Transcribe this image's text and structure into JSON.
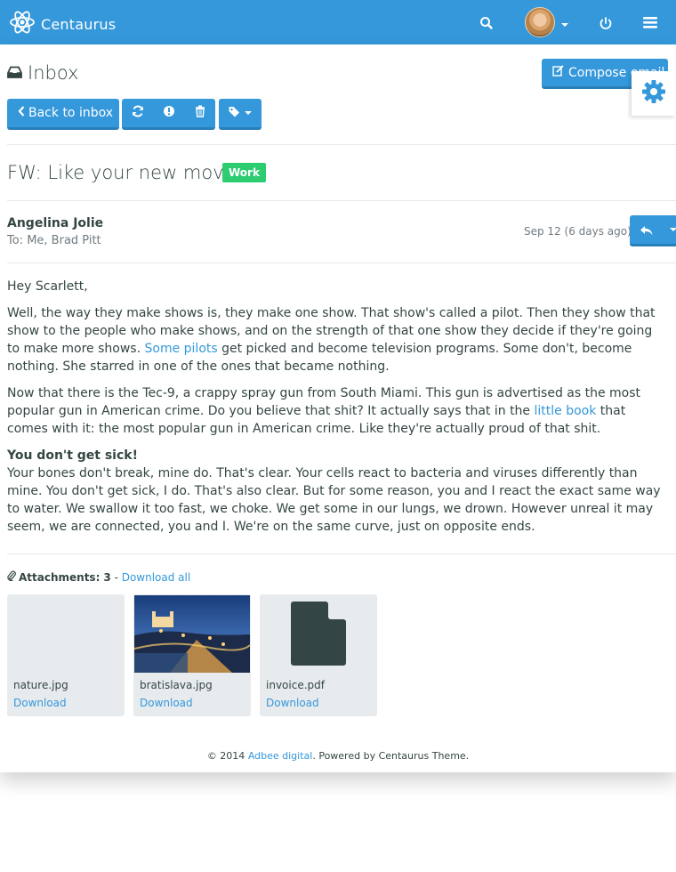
{
  "navbar": {
    "brand": "Centaurus",
    "icons": [
      "atom-logo-icon",
      "search-icon",
      "user-avatar",
      "power-icon",
      "menu-icon"
    ]
  },
  "inbox": {
    "title": "Inbox",
    "compose_label": "Compose email",
    "back_label": "Back to inbox",
    "toolbar_icons": [
      "refresh-icon",
      "exclamation-icon",
      "trash-icon",
      "tag-icon"
    ]
  },
  "email": {
    "subject": "FW: Like your new movie",
    "label": "Work",
    "sender": "Angelina Jolie",
    "recipients": "To: Me, Brad Pitt",
    "date": "Sep 12 (6 days ago)",
    "greeting": "Hey Scarlett,",
    "p1_a": "Well, the way they make shows is, they make one show. That show's called a pilot. Then they show that show to the people who make shows, and on the strength of that one show they decide if they're going to make more shows. ",
    "p1_link": "Some pilots",
    "p1_b": " get picked and become television programs. Some don't, become nothing. She starred in one of the ones that became nothing.",
    "p2_a": "Now that there is the Tec-9, a crappy spray gun from South Miami. This gun is advertised as the most popular gun in American crime. Do you believe that shit? It actually says that in the ",
    "p2_link": "little book",
    "p2_b": " that comes with it: the most popular gun in American crime. Like they're actually proud of that shit.",
    "p3_heading": "You don't get sick!",
    "p3_text": "Your bones don't break, mine do. That's clear. Your cells react to bacteria and viruses differently than mine. You don't get sick, I do. That's also clear. But for some reason, you and I react the exact same way to water. We swallow it too fast, we choke. We get some in our lungs, we drown. However unreal it may seem, we are connected, you and I. We're on the same curve, just on opposite ends."
  },
  "attachments": {
    "label": "Attachments:",
    "count": "3",
    "separator": " - ",
    "download_all": "Download all",
    "items": [
      {
        "name": "nature.jpg",
        "download": "Download"
      },
      {
        "name": "bratislava.jpg",
        "download": "Download"
      },
      {
        "name": "invoice.pdf",
        "download": "Download"
      }
    ]
  },
  "footer": {
    "prefix": "© 2014 ",
    "company": "Adbee digital",
    "suffix": ". Powered by Centaurus Theme."
  },
  "colors": {
    "primary": "#3498db",
    "primary_dark": "#2980b9",
    "success": "#2ecc71",
    "text": "#344644",
    "muted": "#707a80",
    "card_bg": "#e8ebee"
  }
}
